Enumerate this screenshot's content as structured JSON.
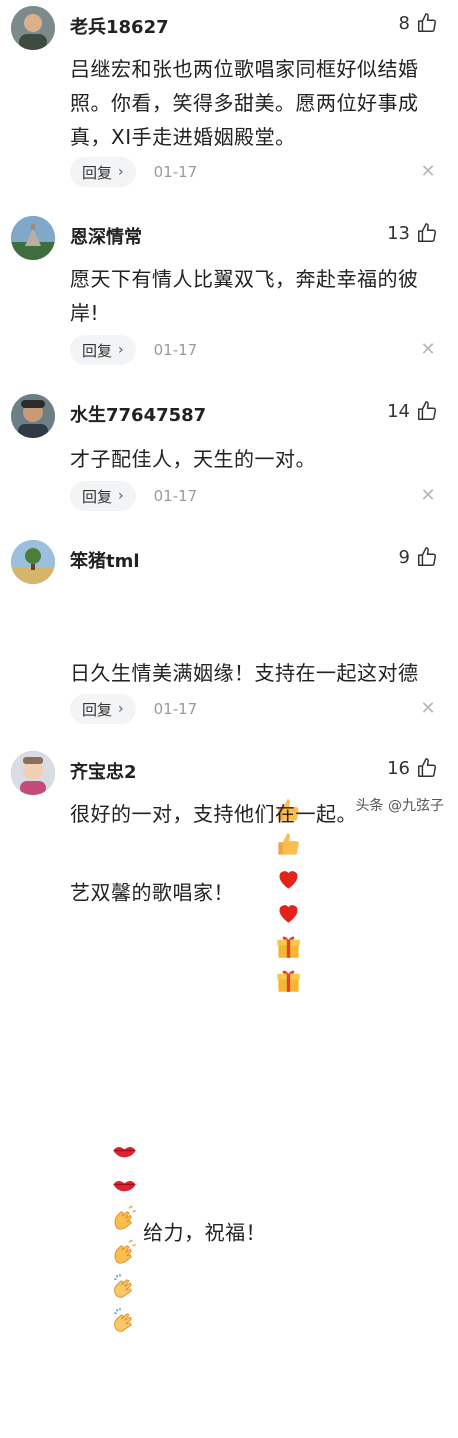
{
  "comments": [
    {
      "name": "老兵18627",
      "likes": "8",
      "text": "吕继宏和张也两位歌唱家同框好似结婚照。你看，笑得多甜美。愿两位好事成真，XI手走进婚姻殿堂。",
      "reply": "回复",
      "date": "01-17"
    },
    {
      "name": "恩深情常",
      "likes": "13",
      "text": "愿天下有情人比翼双飞，奔赴幸福的彼岸!",
      "reply": "回复",
      "date": "01-17"
    },
    {
      "name": "水生77647587",
      "likes": "14",
      "text": "才子配佳人，天生的一对。",
      "reply": "回复",
      "date": "01-17"
    },
    {
      "name": "笨猪tml",
      "likes": "9",
      "text_line1": "日久生情美满姻缘！支持在一起这对德",
      "text_line2_prefix": "艺双馨的歌唱家！",
      "text_line3_suffix": "给力，祝福！",
      "reply": "回复",
      "date": "01-17"
    },
    {
      "name": "齐宝忠2",
      "likes": "16",
      "text": "很好的一对，支持他们在一起。",
      "reply": "回复",
      "date": "01-17"
    }
  ],
  "watermark": "头条 @九弦子",
  "icons": {
    "like": "thumbs-up-icon",
    "close": "close-icon",
    "chevron": "chevron-right-icon"
  },
  "emoji_names": [
    "thumbs-up",
    "thumbs-up",
    "red-heart",
    "red-heart",
    "gift",
    "gift",
    "kiss-lips",
    "kiss-lips",
    "clapping-hands",
    "clapping-hands",
    "applause",
    "applause"
  ]
}
